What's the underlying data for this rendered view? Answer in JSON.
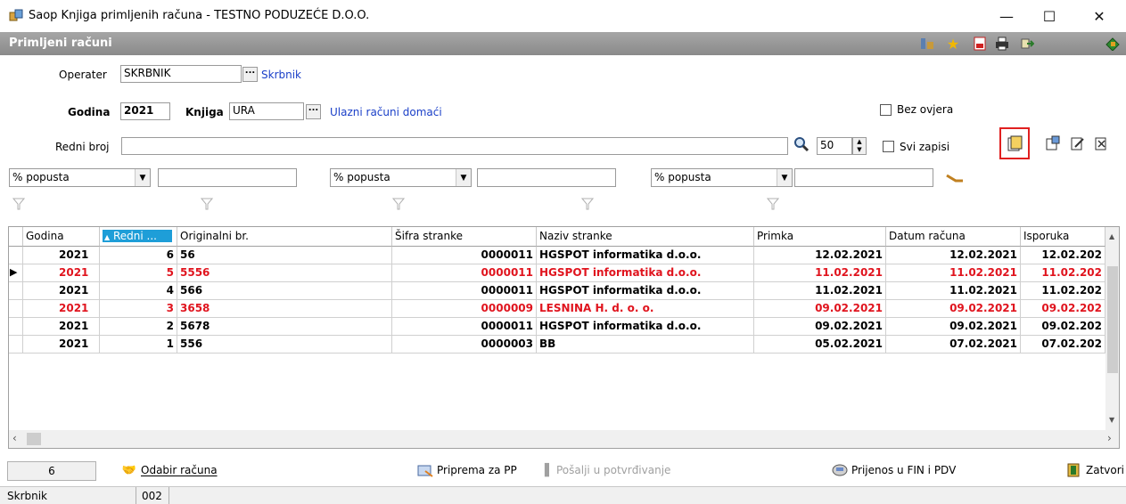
{
  "window": {
    "title": "Saop Knjiga primljenih računa - TESTNO PODUZEĆE D.O.O.",
    "minimize": "—",
    "maximize": "☐",
    "close": "✕"
  },
  "header": {
    "title": "Primljeni računi"
  },
  "form": {
    "operater_label": "Operater",
    "operater_value": "SKRBNIK",
    "operater_link": "Skrbnik",
    "godina_label": "Godina",
    "godina_value": "2021",
    "knjiga_label": "Knjiga",
    "knjiga_value": "URA",
    "knjiga_link": "Ulazni računi domaći",
    "bez_ovjera": "Bez ovjera",
    "redni_broj_label": "Redni broj",
    "redni_broj_value": "",
    "count_value": "50",
    "svi_zapisi": "Svi zapisi",
    "filters": [
      "% popusta",
      "% popusta",
      "% popusta"
    ]
  },
  "grid": {
    "columns": [
      "Godina",
      "Redni ...",
      "Originalni br.",
      "Šifra stranke",
      "Naziv stranke",
      "Primka",
      "Datum računa",
      "Isporuka"
    ],
    "rows": [
      {
        "godina": "2021",
        "redni": "6",
        "orig": "56",
        "sifra": "0000011",
        "naziv": "HGSPOT informatika d.o.o.",
        "primka": "12.02.2021",
        "datum": "12.02.2021",
        "isporuka": "12.02.202",
        "red": false,
        "current": false
      },
      {
        "godina": "2021",
        "redni": "5",
        "orig": "5556",
        "sifra": "0000011",
        "naziv": "HGSPOT informatika d.o.o.",
        "primka": "11.02.2021",
        "datum": "11.02.2021",
        "isporuka": "11.02.202",
        "red": true,
        "current": true
      },
      {
        "godina": "2021",
        "redni": "4",
        "orig": "566",
        "sifra": "0000011",
        "naziv": "HGSPOT informatika d.o.o.",
        "primka": "11.02.2021",
        "datum": "11.02.2021",
        "isporuka": "11.02.202",
        "red": false,
        "current": false
      },
      {
        "godina": "2021",
        "redni": "3",
        "orig": "3658",
        "sifra": "0000009",
        "naziv": "LESNINA H. d. o. o.",
        "primka": "09.02.2021",
        "datum": "09.02.2021",
        "isporuka": "09.02.202",
        "red": true,
        "current": false
      },
      {
        "godina": "2021",
        "redni": "2",
        "orig": "5678",
        "sifra": "0000011",
        "naziv": "HGSPOT informatika d.o.o.",
        "primka": "09.02.2021",
        "datum": "09.02.2021",
        "isporuka": "09.02.202",
        "red": false,
        "current": false
      },
      {
        "godina": "2021",
        "redni": "1",
        "orig": "556",
        "sifra": "0000003",
        "naziv": "BB",
        "primka": "05.02.2021",
        "datum": "07.02.2021",
        "isporuka": "07.02.202",
        "red": false,
        "current": false
      }
    ]
  },
  "bottom": {
    "count": "6",
    "odabir": "Odabir računa",
    "priprema": "Priprema za PP",
    "posalji": "Pošalji u potvrđivanje",
    "prijenos": "Prijenos u FIN i PDV",
    "zatvori": "Zatvori"
  },
  "status": {
    "user": "Skrbnik",
    "code": "002"
  },
  "colors": {
    "red_row": "#e0141e",
    "link": "#1a3fc8",
    "header_bg": "#8a8a8a",
    "highlight": "#e02020"
  }
}
